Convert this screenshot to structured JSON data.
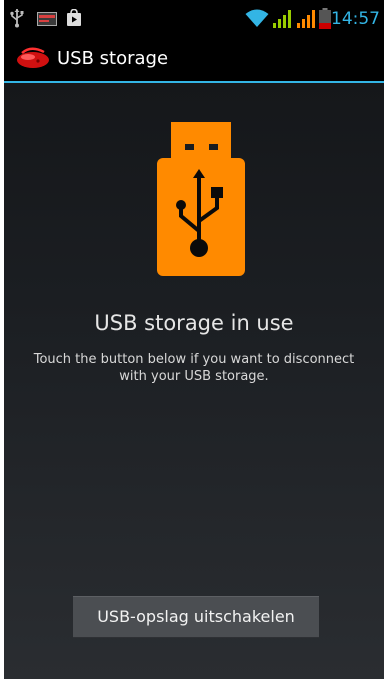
{
  "status_bar": {
    "time": "14:57",
    "icons": [
      "usb-icon",
      "notification-icon",
      "play-store-icon",
      "wifi-icon",
      "signal-icon",
      "signal-icon",
      "battery-icon"
    ],
    "accent_color": "#33b5e5",
    "signal_color": "#99cc00",
    "battery_color": "#cc0000"
  },
  "action_bar": {
    "title": "USB storage",
    "divider_color": "#33b5e5"
  },
  "content": {
    "heading": "USB storage in use",
    "description": "Touch the button below if you want to disconnect with your USB storage.",
    "illustration_color": "#ff8a00"
  },
  "button": {
    "label": "USB-opslag uitschakelen"
  }
}
